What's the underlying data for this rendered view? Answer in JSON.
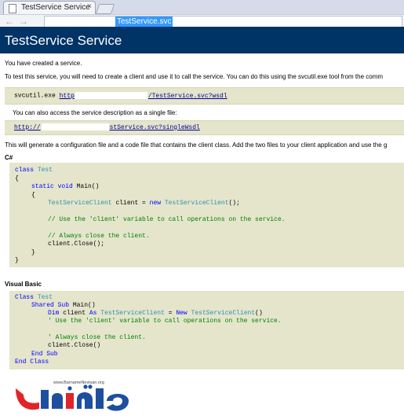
{
  "browser": {
    "tab_title": "TestService Service",
    "tab_close": "×",
    "back": "←",
    "forward": "→",
    "url_highlighted": "TestService.svc"
  },
  "page": {
    "title": "TestService Service",
    "created_text": "You have created a service.",
    "instructions_text": "To test this service, you will need to create a client and use it to call the service. You can do this using the svcutil.exe tool from the comm",
    "svcutil_cmd": "svcutil.exe",
    "wsdl_url_prefix": "http",
    "wsdl_url_suffix": "/TestService.svc?wsdl",
    "single_file_text": "You can also access the service description as a single file:",
    "single_url_prefix": "http://",
    "single_url_suffix": "stService.svc?singleWsdl",
    "generate_text": "This will generate a configuration file and a code file that contains the client class. Add the two files to your client application and use the g",
    "csharp_heading": "C#",
    "vb_heading": "Visual Basic"
  },
  "code_csharp": {
    "l1_kw": "class",
    "l1_ty": "Test",
    "l2": "{",
    "l3_kw": "static void",
    "l3_pl": "Main()",
    "l4": "{",
    "l5_ty": "TestServiceClient",
    "l5_pl1": "client =",
    "l5_kw": "new",
    "l5_ty2": "TestServiceClient",
    "l5_pl2": "();",
    "l6_cm": "// Use the 'client' variable to call operations on the service.",
    "l7_cm": "// Always close the client.",
    "l8_pl": "client.Close();",
    "l9": "}",
    "l10": "}"
  },
  "code_vb": {
    "l1_kw": "Class",
    "l1_ty": "Test",
    "l2_kw": "Shared Sub",
    "l2_pl": "Main()",
    "l3_kw": "Dim",
    "l3_pl1": "client",
    "l3_kw2": "As",
    "l3_ty": "TestServiceClient",
    "l3_pl2": "=",
    "l3_kw3": "New",
    "l3_ty2": "TestServiceClient",
    "l3_pl3": "()",
    "l4_cm": "' Use the 'client' variable to call operations on the service.",
    "l5_cm": "' Always close the client.",
    "l6_pl": "client.Close()",
    "l7_kw": "End Sub",
    "l8_kw": "End Class"
  },
  "logo": {
    "site": "www.BarnameNevisan.org"
  },
  "colors": {
    "banner": "#003366",
    "code_bg": "#e5e5cc",
    "keyword": "#0000ff",
    "type": "#2b91af",
    "comment": "#008000",
    "logo_blue": "#1d4f9e",
    "logo_red": "#e0252a"
  }
}
